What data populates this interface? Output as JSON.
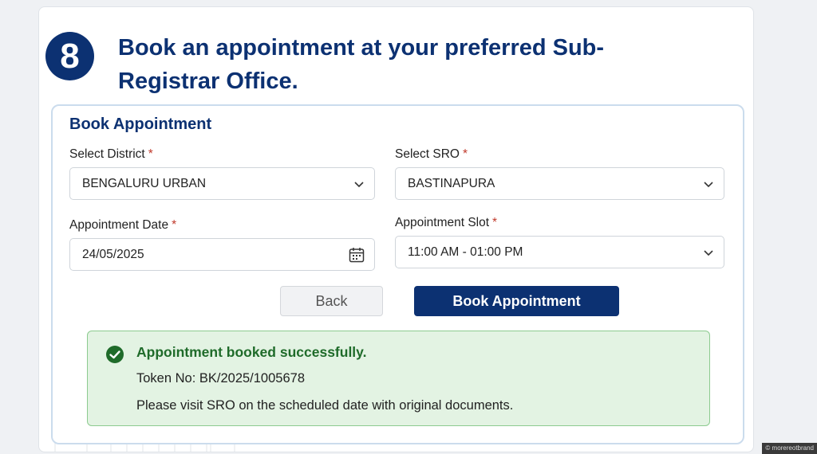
{
  "step": {
    "number": "8",
    "title": "Book an appointment at your preferred Sub-Registrar Office."
  },
  "form": {
    "title": "Book Appointment",
    "district": {
      "label": "Select District",
      "required": "*",
      "value": "BENGALURU URBAN"
    },
    "sro": {
      "label": "Select SRO",
      "required": "*",
      "value": "BASTINAPURA"
    },
    "date": {
      "label": "Appointment Date",
      "required": "*",
      "value": "24/05/2025"
    },
    "slot": {
      "label": "Appointment Slot",
      "required": "*",
      "value": "11:00 AM - 01:00 PM"
    },
    "back_label": "Back",
    "book_label": "Book Appointment"
  },
  "success": {
    "message": "Appointment booked successfully.",
    "token": "Token No: BK/2025/1005678",
    "note": "Please visit SRO on the scheduled date with original documents."
  },
  "credit": "© morereotbrand",
  "colors": {
    "primary": "#0c3172",
    "success_bg": "#e3f3e3",
    "success_border": "#8ccb8f",
    "success_text": "#1f6b2a",
    "required": "#c0392b"
  }
}
